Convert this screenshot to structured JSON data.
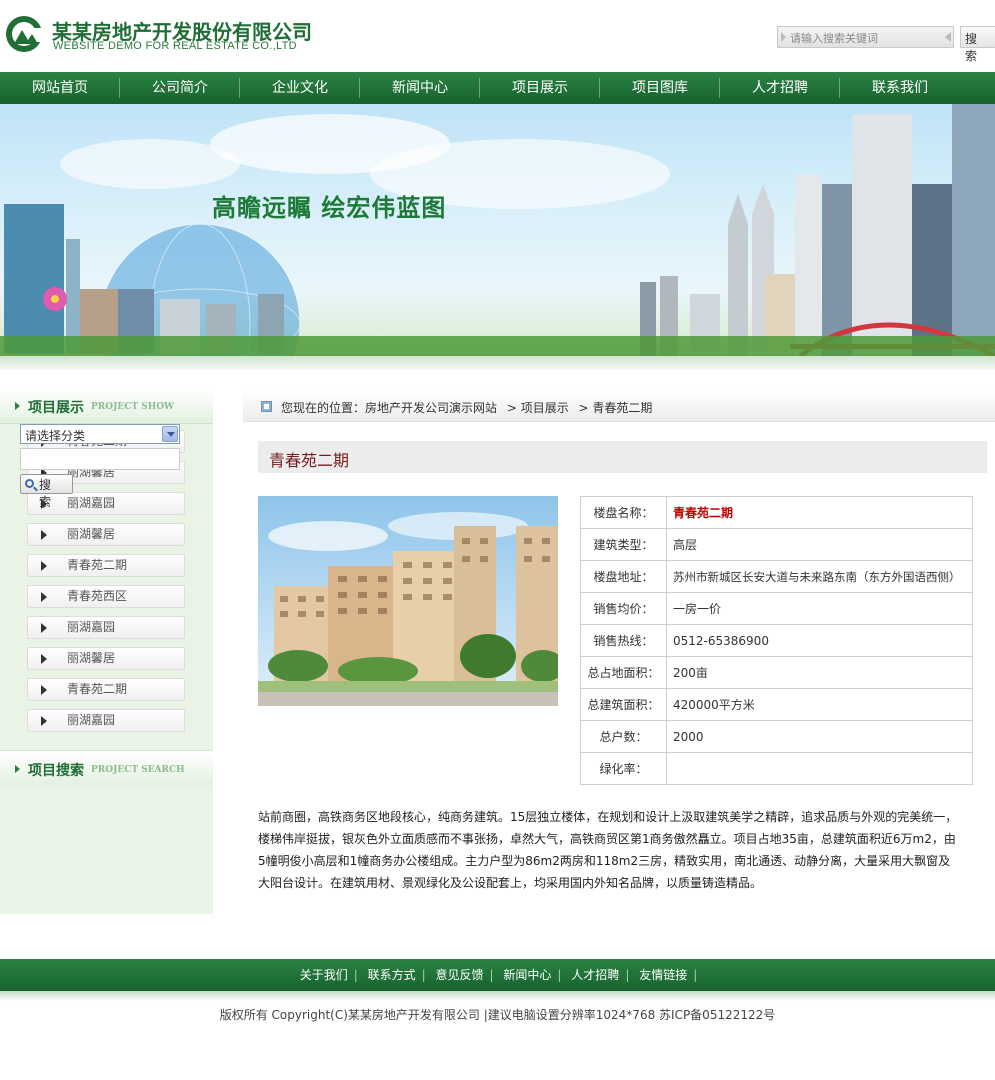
{
  "header": {
    "logo_cn": "某某房地产开发股份有限公司",
    "logo_en": "WEBSITE DEMO FOR REAL ESTATE CO.,LTD",
    "search_placeholder": "请输入搜索关键词",
    "search_button": "搜 索"
  },
  "nav": [
    "网站首页",
    "公司简介",
    "企业文化",
    "新闻中心",
    "项目展示",
    "项目图库",
    "人才招聘",
    "联系我们"
  ],
  "banner": {
    "slogan": "高瞻远瞩  绘宏伟蓝图"
  },
  "sidebar": {
    "project_show_title": "项目展示",
    "project_show_en": "PROJECT SHOW",
    "items": [
      "青春苑二期",
      "丽湖馨居",
      "丽湖嘉园",
      "丽湖馨居",
      "青春苑二期",
      "青春苑西区",
      "丽湖嘉园",
      "丽湖馨居",
      "青春苑二期",
      "丽湖嘉园"
    ],
    "project_search_title": "项目搜索",
    "project_search_en": "PROJECT SEARCH",
    "category_selected": "请选择分类",
    "search_button": "搜 索"
  },
  "breadcrumb": {
    "prefix": "您现在的位置：房地产开发公司演示网站",
    "level1": "> 项目展示",
    "level2": "> 青春苑二期"
  },
  "project": {
    "title": "青春苑二期",
    "rows": [
      {
        "label": "楼盘名称：",
        "value": "青春苑二期"
      },
      {
        "label": "建筑类型：",
        "value": "高层"
      },
      {
        "label": "楼盘地址：",
        "value": "苏州市新城区长安大道与未来路东南（东方外国语西侧）"
      },
      {
        "label": "销售均价：",
        "value": "一房一价"
      },
      {
        "label": "销售热线：",
        "value": "0512-65386900"
      },
      {
        "label": "总占地面积：",
        "value": "200亩"
      },
      {
        "label": "总建筑面积：",
        "value": "420000平方米"
      },
      {
        "label": "总户数：",
        "value": "2000"
      },
      {
        "label": "绿化率：",
        "value": ""
      }
    ],
    "description": "站前商圈，高铁商务区地段核心，纯商务建筑。15层独立楼体，在规划和设计上汲取建筑美学之精辟，追求品质与外观的完美统一，楼梯伟岸挺拔，银灰色外立面质感而不事张扬，卓然大气，高铁商贸区第1商务傲然矗立。项目占地35亩，总建筑面积近6万m2，由5幢明俊小高层和1幢商务办公楼组成。主力户型为86m2两房和118m2三房，精致实用，南北通透、动静分离，大量采用大飘窗及大阳台设计。在建筑用材、景观绿化及公设配套上，均采用国内外知名品牌，以质量铸造精品。"
  },
  "footer": {
    "links": [
      "关于我们",
      "联系方式",
      "意见反馈",
      "新闻中心",
      "人才招聘",
      "友情链接"
    ],
    "copyright": "版权所有  Copyright(C)某某房地产开发有限公司  |建议电脑设置分辨率1024*768 苏ICP备05122122号"
  },
  "colors": {
    "brand_green": "#1f6e35",
    "nav_green": "#17622d",
    "title_red": "#7a1b1b",
    "highlight_red": "#c00000"
  }
}
